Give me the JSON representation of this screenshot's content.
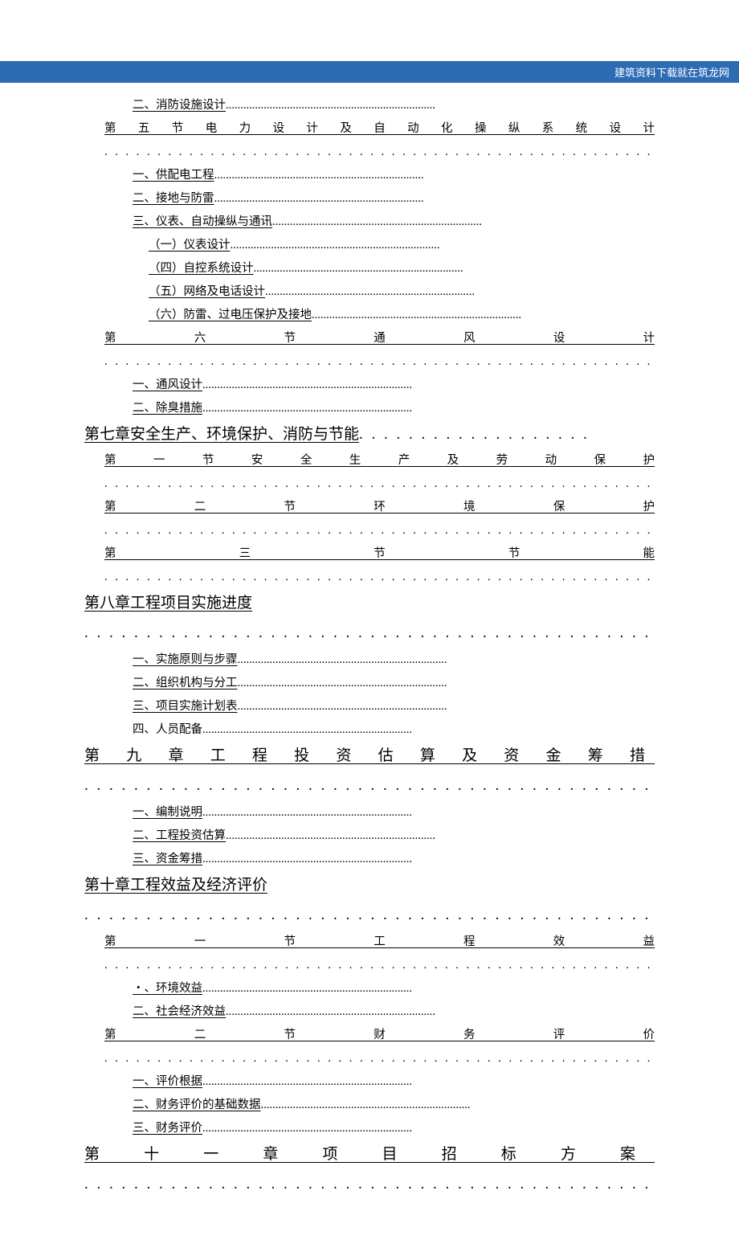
{
  "header": {
    "text": "建筑资料下载就在筑龙网"
  },
  "toc": {
    "line01": "二、消防设施设计",
    "sec5": "第五节电力设计及自动化操纵系统设计",
    "line03": "一、供配电工程",
    "line04": "二、接地与防雷",
    "line05": "三、仪表、自动操纵与通讯",
    "line06": "（一）仪表设计",
    "line07": "（四）自控系统设计",
    "line08": "（五）网络及电话设计",
    "line09": "（六）防雷、过电压保护及接地",
    "sec6": "第六节通风设计",
    "line11": "一、通风设计",
    "line12": "二、除臭措施",
    "chap7": "第七章安全生产、环境保护、消防与节能",
    "sec7_1": "第一节安全生产及劳动保护",
    "sec7_2": "第二节环境保护",
    "sec7_3": "第三节节能",
    "chap8": "第八章工程项目实施进度",
    "line81": "一、实施原则与步骤",
    "line82": "二、组织机构与分工",
    "line83": "三、项目实施计划表",
    "line84": "四、人员配备",
    "chap9": "第九章工程投资估算及资金筹措",
    "line91": "一、编制说明",
    "line92": "二、工程投资估算",
    "line93": "三、资金筹措",
    "chap10": "第十章工程效益及经济评价",
    "sec10_1": "第一节工程效益",
    "line101": "・、环境效益",
    "line102": "二、社会经济效益",
    "sec10_2": "第二节财务评价",
    "line104": "一、评价根据",
    "line105": "二、财务评价的基础数据",
    "line106": "三、财务评价",
    "chap11": "第十一章项目招标方案"
  },
  "dots40": "........................................................................",
  "dotsline": ". . . . . . . . . . . . . . . . . . . . . . . . . . . . . . . . . . . . . . . . . . . . . . . . . . . . . . . . . . . . . ."
}
